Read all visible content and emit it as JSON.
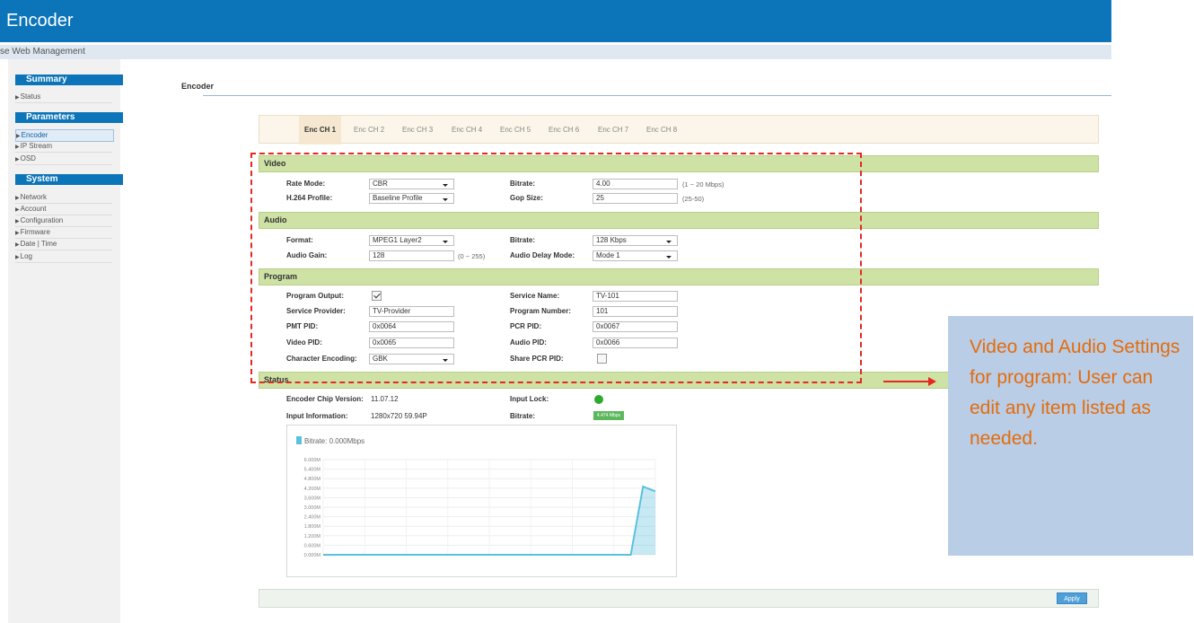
{
  "header": {
    "title": "Encoder",
    "subtitle": "se Web Management"
  },
  "sidebar": {
    "summary": {
      "title": "Summary",
      "items": [
        "Status"
      ]
    },
    "parameters": {
      "title": "Parameters",
      "items": [
        "Encoder",
        "IP Stream",
        "OSD"
      ]
    },
    "system": {
      "title": "System",
      "items": [
        "Network",
        "Account",
        "Configuration",
        "Firmware",
        "Date | Time",
        "Log"
      ]
    }
  },
  "main": {
    "title": "Encoder"
  },
  "tabs": [
    "Enc CH 1",
    "Enc CH 2",
    "Enc CH 3",
    "Enc CH 4",
    "Enc CH 5",
    "Enc CH 6",
    "Enc CH 7",
    "Enc CH 8"
  ],
  "video": {
    "title": "Video",
    "rate_mode_label": "Rate Mode:",
    "rate_mode": "CBR",
    "bitrate_label": "Bitrate:",
    "bitrate": "4.00",
    "bitrate_hint": "(1 ~ 20 Mbps)",
    "profile_label": "H.264 Profile:",
    "profile": "Baseline Profile",
    "gop_label": "Gop Size:",
    "gop": "25",
    "gop_hint": "(25-50)"
  },
  "audio": {
    "title": "Audio",
    "format_label": "Format:",
    "format": "MPEG1 Layer2",
    "bitrate_label": "Bitrate:",
    "bitrate": "128 Kbps",
    "gain_label": "Audio Gain:",
    "gain": "128",
    "gain_hint": "(0 ~ 255)",
    "delay_label": "Audio Delay Mode:",
    "delay": "Mode 1"
  },
  "program": {
    "title": "Program",
    "output_label": "Program Output:",
    "output_checked": true,
    "service_name_label": "Service Name:",
    "service_name": "TV-101",
    "provider_label": "Service Provider:",
    "provider": "TV-Provider",
    "number_label": "Program Number:",
    "number": "101",
    "pmt_label": "PMT PID:",
    "pmt": "0x0064",
    "pcr_label": "PCR PID:",
    "pcr": "0x0067",
    "vpid_label": "Video PID:",
    "vpid": "0x0065",
    "apid_label": "Audio PID:",
    "apid": "0x0066",
    "encoding_label": "Character Encoding:",
    "encoding": "GBK",
    "share_label": "Share PCR PID:",
    "share_checked": false
  },
  "status": {
    "title": "Status",
    "chip_label": "Encoder Chip Version:",
    "chip": "11.07.12",
    "lock_label": "Input Lock:",
    "lock_color": "#2eaa2e",
    "info_label": "Input Information:",
    "info": "1280x720 59.94P",
    "bitrate_label": "Bitrate:",
    "bitrate": "4.474 Mbps"
  },
  "chart_data": {
    "type": "area",
    "legend": "Bitrate: 0.000Mbps",
    "ylabels": [
      "6.000M",
      "5.400M",
      "4.800M",
      "4.200M",
      "3.600M",
      "3.000M",
      "2.400M",
      "1.800M",
      "1.200M",
      "0.600M",
      "0.000M"
    ],
    "ylim": [
      0,
      6
    ],
    "series": [
      {
        "values": [
          0,
          0,
          0,
          0,
          0,
          0,
          0,
          0,
          0,
          0,
          0,
          0,
          0,
          0,
          0,
          0,
          0,
          0,
          0,
          0,
          0,
          0,
          0,
          0,
          0,
          0,
          4.3,
          4.0
        ]
      }
    ],
    "series_color": "#5bc0de",
    "grid": true
  },
  "apply_label": "Apply",
  "callout": {
    "text": "Video and Audio Settings for program: User can edit any item listed as needed."
  }
}
